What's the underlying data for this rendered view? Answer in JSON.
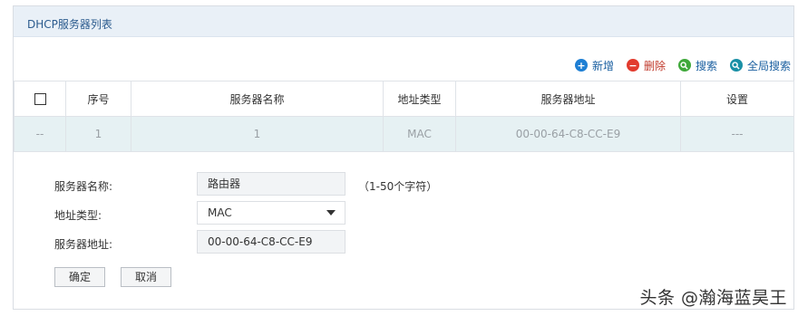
{
  "panel": {
    "title": "DHCP服务器列表"
  },
  "toolbar": {
    "add_label": "新增",
    "delete_label": "删除",
    "search_label": "搜索",
    "global_search_label": "全局搜索"
  },
  "table": {
    "headers": [
      "序号",
      "服务器名称",
      "地址类型",
      "服务器地址",
      "设置"
    ],
    "rows": [
      {
        "check": "--",
        "index": "1",
        "name": "1",
        "type": "MAC",
        "address": "00-00-64-C8-CC-E9",
        "settings": "---"
      }
    ]
  },
  "form": {
    "name_label": "服务器名称:",
    "name_value": "路由器",
    "name_hint": "（1-50个字符）",
    "type_label": "地址类型:",
    "type_value": "MAC",
    "address_label": "服务器地址:",
    "address_value": "00-00-64-C8-CC-E9",
    "confirm_label": "确定",
    "cancel_label": "取消"
  },
  "watermark": "头条 @瀚海蓝昊王",
  "colors": {
    "header_bg": "#e9f0f7",
    "row_bg": "#e6f1f3",
    "title_text": "#2b5b8e",
    "add_icon": "#1e7fd4",
    "delete_icon": "#e23b2e",
    "search_icon": "#3fa83a",
    "global_search_icon": "#1a90a6"
  },
  "icons": {
    "add": "plus-circle-icon",
    "delete": "minus-circle-icon",
    "search": "search-icon",
    "global_search": "global-search-icon"
  }
}
